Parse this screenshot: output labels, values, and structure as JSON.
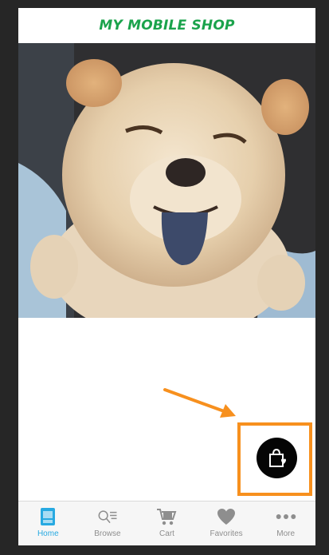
{
  "header": {
    "title": "MY MOBILE SHOP"
  },
  "colors": {
    "title": "#1ba34c",
    "active_tab": "#27a9e1",
    "inactive_tab": "#8e8e8e",
    "annotation": "#f7901e"
  },
  "hero": {
    "subject": "fluffy chow chow puppy photo"
  },
  "fab": {
    "icon": "shopping-bag-heart-icon"
  },
  "tabs": [
    {
      "label": "Home",
      "icon": "home-icon",
      "active": true
    },
    {
      "label": "Browse",
      "icon": "search-list-icon",
      "active": false
    },
    {
      "label": "Cart",
      "icon": "cart-icon",
      "active": false
    },
    {
      "label": "Favorites",
      "icon": "heart-icon",
      "active": false
    },
    {
      "label": "More",
      "icon": "more-dots-icon",
      "active": false
    }
  ]
}
